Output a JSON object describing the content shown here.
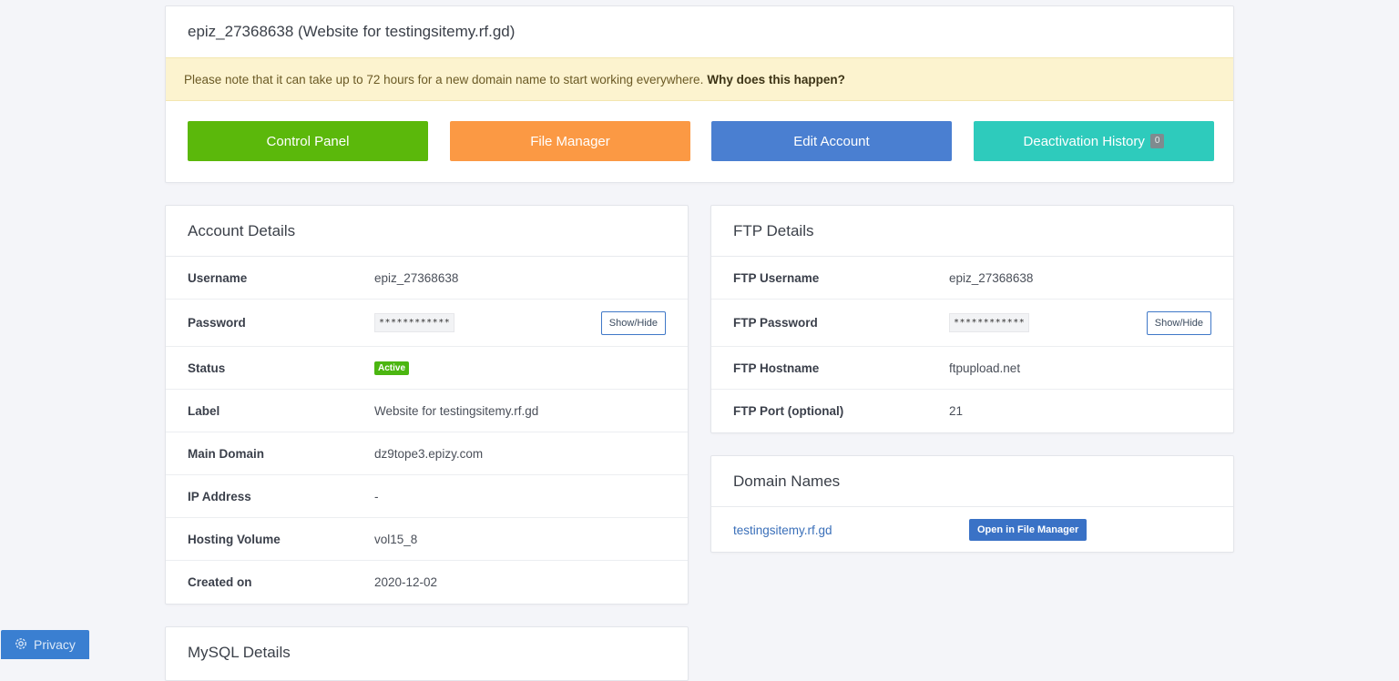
{
  "account": {
    "title": "epiz_27368638 (Website for testingsitemy.rf.gd)",
    "notice_text": "Please note that it can take up to 72 hours for a new domain name to start working everywhere.",
    "notice_link": "Why does this happen?"
  },
  "actions": {
    "control_panel": "Control Panel",
    "file_manager": "File Manager",
    "edit_account": "Edit Account",
    "deactivation_history": "Deactivation History",
    "deactivation_count": "0"
  },
  "colors": {
    "control_panel": "#5bb80b",
    "file_manager": "#fb9944",
    "edit_account": "#4a7fd1",
    "deactivation_history": "#2ecbbc"
  },
  "account_details": {
    "title": "Account Details",
    "rows": [
      {
        "label": "Username",
        "value": "epiz_27368638"
      },
      {
        "label": "Password",
        "value": "************"
      },
      {
        "label": "Status",
        "value": "Active"
      },
      {
        "label": "Label",
        "value": "Website for testingsitemy.rf.gd"
      },
      {
        "label": "Main Domain",
        "value": "dz9tope3.epizy.com"
      },
      {
        "label": "IP Address",
        "value": "-"
      },
      {
        "label": "Hosting Volume",
        "value": "vol15_8"
      },
      {
        "label": "Created on",
        "value": "2020-12-02"
      }
    ],
    "show_hide": "Show/Hide"
  },
  "ftp_details": {
    "title": "FTP Details",
    "rows": [
      {
        "label": "FTP Username",
        "value": "epiz_27368638"
      },
      {
        "label": "FTP Password",
        "value": "************"
      },
      {
        "label": "FTP Hostname",
        "value": "ftpupload.net"
      },
      {
        "label": "FTP Port (optional)",
        "value": "21"
      }
    ],
    "show_hide": "Show/Hide"
  },
  "domain_names": {
    "title": "Domain Names",
    "domain": "testingsitemy.rf.gd",
    "open_button": "Open in File Manager"
  },
  "mysql": {
    "title": "MySQL Details"
  },
  "privacy": {
    "label": "Privacy",
    "icon": "gear-icon"
  }
}
